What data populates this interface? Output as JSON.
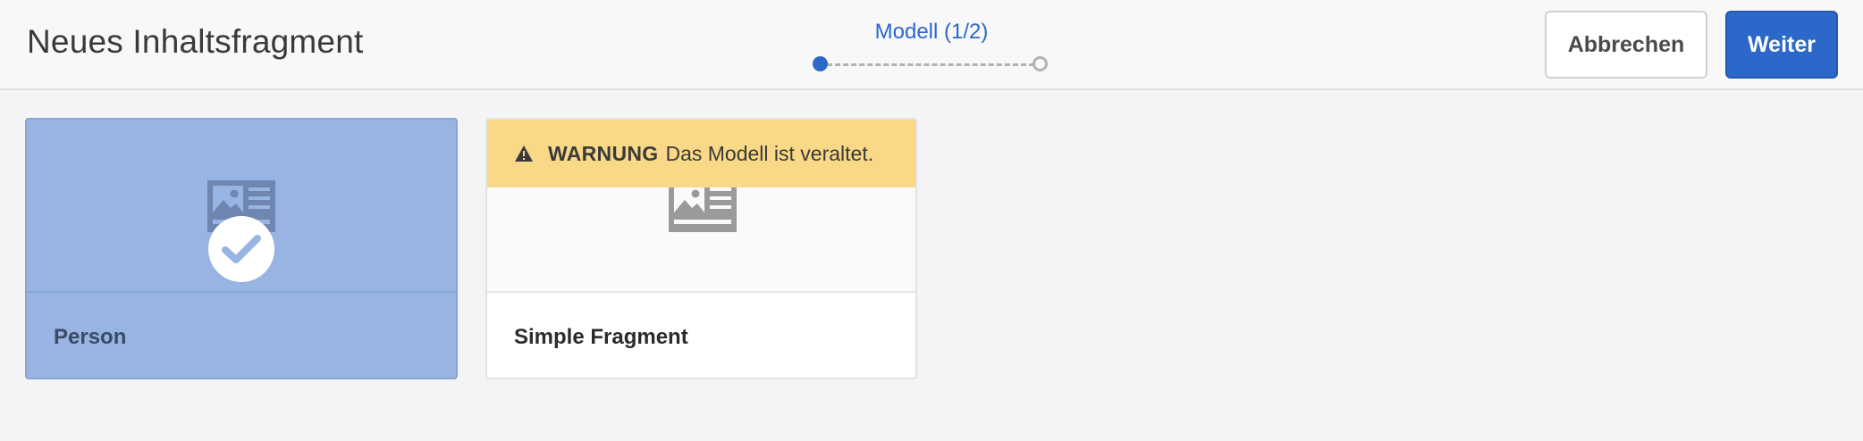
{
  "header": {
    "title": "Neues Inhaltsfragment",
    "wizard": {
      "label": "Modell (1/2)",
      "current_step": 1,
      "total_steps": 2
    },
    "cancel_label": "Abbrechen",
    "next_label": "Weiter"
  },
  "models": [
    {
      "title": "Person",
      "selected": true,
      "icon": "fragment-model-icon"
    },
    {
      "title": "Simple Fragment",
      "selected": false,
      "icon": "fragment-model-icon",
      "warning": {
        "label": "WARNUNG",
        "text": "Das Modell ist veraltet."
      }
    }
  ],
  "colors": {
    "accent": "#2c68c9",
    "selected_card": "#97b4e2",
    "warning": "#f9d887"
  }
}
